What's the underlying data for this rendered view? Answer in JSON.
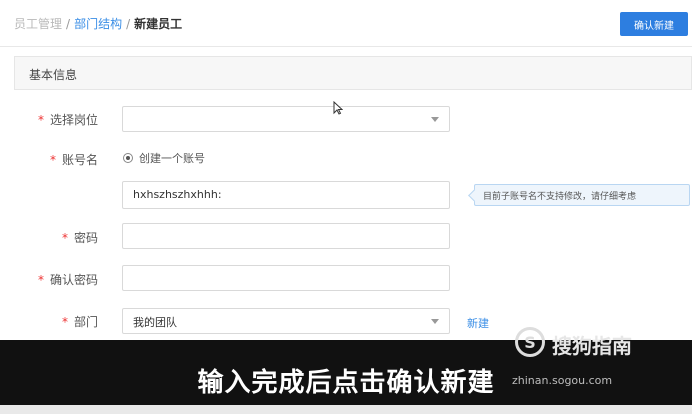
{
  "breadcrumb": {
    "items": [
      "员工管理",
      "部门结构",
      "新建员工"
    ],
    "separator": "/"
  },
  "header": {
    "confirm_label": "确认新建"
  },
  "section": {
    "title": "基本信息"
  },
  "form": {
    "position": {
      "label": "选择岗位",
      "value": ""
    },
    "account": {
      "label": "账号名",
      "radio_label": "创建一个账号",
      "value": "hxhszhszhxhhh:",
      "tip": "目前子账号名不支持修改，请仔细考虑"
    },
    "password": {
      "label": "密码",
      "value": ""
    },
    "confirm_password": {
      "label": "确认密码",
      "value": ""
    },
    "department": {
      "label": "部门",
      "value": "我的团队",
      "new_link": "新建"
    },
    "required_mark": "*"
  },
  "overlay": {
    "subtitle": "输入完成后点击确认新建",
    "brand": {
      "logo_letter": "S",
      "name": "搜狗指南",
      "url": "zhinan.sogou.com"
    }
  },
  "colors": {
    "accent": "#2d7ee0",
    "link": "#3a8ee6",
    "required": "#e33333"
  }
}
